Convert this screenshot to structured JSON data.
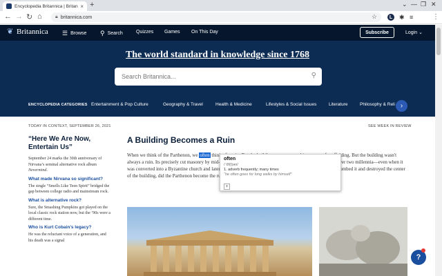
{
  "browser": {
    "tab_title": "Encyclopedia Britannica | Britann",
    "tab_close": "×",
    "new_tab": "+",
    "url": "britannica.com",
    "window_controls": [
      "⌄",
      "—",
      "❐",
      "✕"
    ]
  },
  "nav": {
    "logo": "Britannica",
    "browse": "Browse",
    "search": "Search",
    "quizzes": "Quizzes",
    "games": "Games",
    "on_this_day": "On This Day",
    "subscribe": "Subscribe",
    "login": "Login ⌄"
  },
  "hero": {
    "headline": "The world standard in knowledge since 1768",
    "search_placeholder": "Search Britannica..."
  },
  "categories": {
    "label": "ENCYCLOPEDIA CATEGORIES",
    "items": [
      "Entertainment & Pop Culture",
      "Geography & Travel",
      "Health & Medicine",
      "Lifestyles & Social Issues",
      "Literature",
      "Philosophy & Reli"
    ]
  },
  "content": {
    "dateline": "TODAY IN CONTEXT, SEPTEMBER 26, 2021",
    "see_week": "SEE WEEK IN REVIEW",
    "sidebar": {
      "title": "“Here We Are Now, Entertain Us”",
      "intro_a": "September 24 marks the 30th anniversary of Nirvana’s seminal alternative rock album ",
      "intro_album": "Nevermind",
      "intro_b": ".",
      "q1": "What made Nirvana so significant?",
      "a1": "The single “Smells Like Teen Spirit” bridged the gap between college radio and mainstream rock.",
      "q2": "What is alternative rock?",
      "a2": "Sure, the Smashing Pumpkins got played on the local classic rock station now, but the ’90s were a different time.",
      "q3": "Who is Kurt Cobain’s legacy?",
      "a3": "He was the reluctant voice of a generation, and his death was a signal"
    },
    "article": {
      "title": "A Building Becomes a Ruin",
      "text_a": "When we think of the Parthenon, we ",
      "text_hl": "often",
      "text_b": " think of a ruin. But the building was cocooned in a maze of scaffolding. But the building wasn't always a ruin. Its precisely cut masonry by mid-5th-century-BCE builders ensured that the temple lasted for over two millennia—even when it was converted into a Byzantine church and later a mosque. Only in 1687, when Venetians fighting the Turks bombed it and destroyed the center of the building, did the Parthenon become the ruin we often think of today."
    }
  },
  "dictionary_popup": {
    "word": "often",
    "pronunciation": "/ˈôf(t)ən/",
    "definition": "1. adverb frequently; many times",
    "example": "“he often goes for long walks by himself”",
    "more": "+"
  },
  "chat": {
    "label": "?"
  }
}
